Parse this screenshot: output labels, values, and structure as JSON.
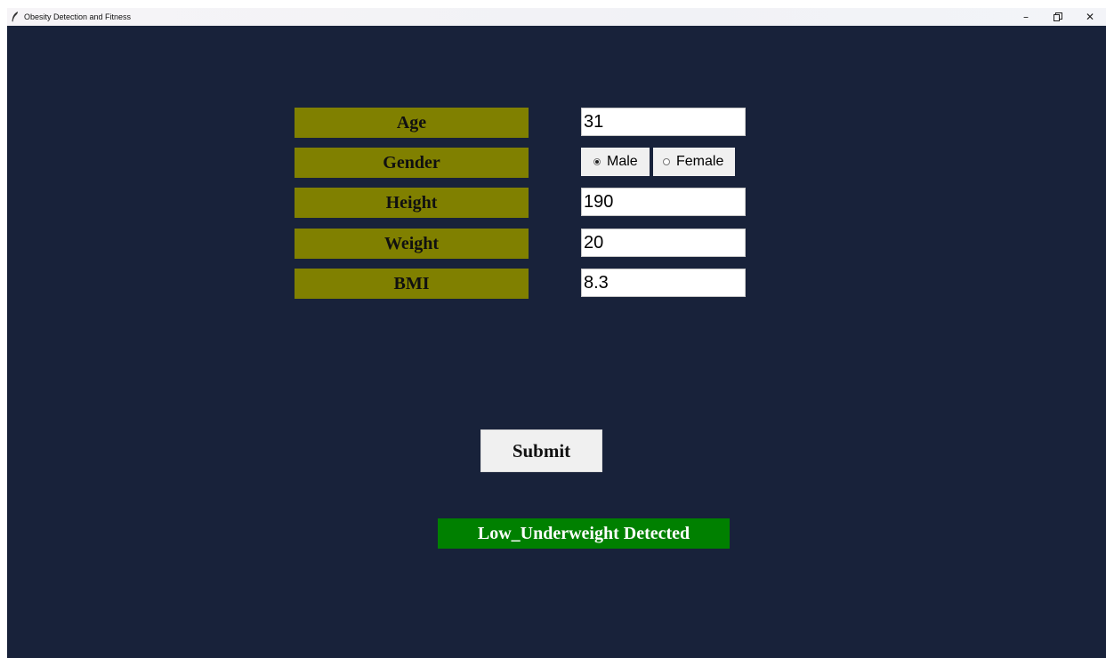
{
  "window": {
    "title": "Obesity Detection and Fitness",
    "controls": {
      "minimize": "–",
      "maximize": "🗗",
      "close": "✕"
    }
  },
  "form": {
    "labels": {
      "age": "Age",
      "gender": "Gender",
      "height": "Height",
      "weight": "Weight",
      "bmi": "BMI"
    },
    "values": {
      "age": "31",
      "height": "190",
      "weight": "20",
      "bmi": "8.3"
    },
    "gender_options": {
      "male": "Male",
      "female": "Female",
      "selected": "Male"
    }
  },
  "actions": {
    "submit_label": "Submit"
  },
  "result": {
    "text": "Low_Underweight Detected"
  },
  "colors": {
    "background": "#18223a",
    "label_bg": "#808000",
    "result_bg": "#008000"
  }
}
